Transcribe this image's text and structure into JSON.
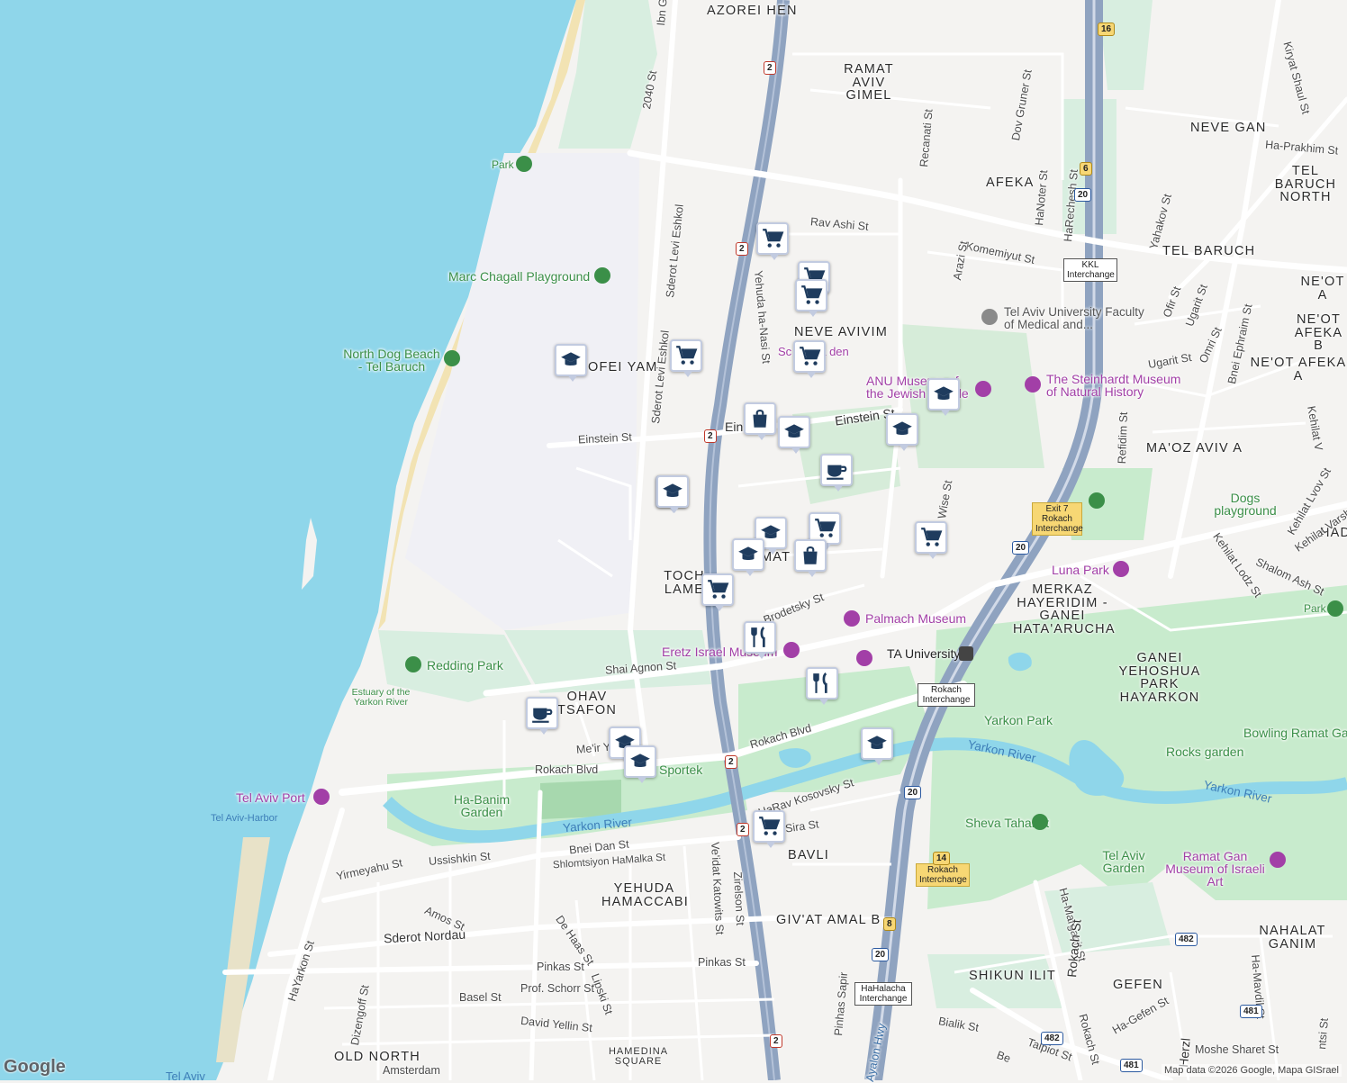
{
  "neighborhoods": [
    {
      "id": "azorei-hen",
      "text": "AZOREI HEN"
    },
    {
      "id": "ramat-aviv-gimel",
      "text": "RAMAT AVIV GIMEL"
    },
    {
      "id": "neve-gan",
      "text": "NEVE GAN"
    },
    {
      "id": "tel-baruch-north",
      "text": "TEL BARUCH NORTH"
    },
    {
      "id": "afeka",
      "text": "AFEKA"
    },
    {
      "id": "tel-baruch",
      "text": "TEL BARUCH"
    },
    {
      "id": "neot-afeka",
      "text": "NE'OT A"
    },
    {
      "id": "neot-afeka-2",
      "text": "NE'OT AFEKA B"
    },
    {
      "id": "neot-afeka-a",
      "text": "NE'OT AFEKA A"
    },
    {
      "id": "neve-avivim",
      "text": "NEVE AVIVIM"
    },
    {
      "id": "tzofei-yam",
      "text": "OFEI YAM"
    },
    {
      "id": "maoz-aviv-a",
      "text": "MA'OZ AVIV A"
    },
    {
      "id": "had",
      "text": "HAD"
    },
    {
      "id": "tochnit-lamed",
      "text": "TOCH LAME"
    },
    {
      "id": "ramat-aviv",
      "text": "MAT"
    },
    {
      "id": "merkaz",
      "text": "MERKAZ HAYERIDIM - GANEI HATA'ARUCHA"
    },
    {
      "id": "ganei-yehoshua",
      "text": "GANEI YEHOSHUA PARK HAYARKON"
    },
    {
      "id": "kochav-hatsafon",
      "text": "OHAV TSAFON"
    },
    {
      "id": "bavli",
      "text": "BAVLI"
    },
    {
      "id": "yehuda-hamaccabi",
      "text": "YEHUDA HAMACCABI"
    },
    {
      "id": "givat-amal",
      "text": "GIV'AT AMAL B"
    },
    {
      "id": "nahalat-ganim",
      "text": "NAHALAT GANIM"
    },
    {
      "id": "shikun-ilit",
      "text": "SHIKUN ILIT"
    },
    {
      "id": "gefen",
      "text": "GEFEN"
    },
    {
      "id": "old-north",
      "text": "OLD NORTH"
    }
  ],
  "streets": [
    {
      "id": "ibn-gvirol",
      "text": "Ibn Gv"
    },
    {
      "id": "st-2040",
      "text": "2040 St"
    },
    {
      "id": "levi-eshkol",
      "text": "Sderot Levi Eshkol"
    },
    {
      "id": "rav-ashi",
      "text": "Rav Ashi St"
    },
    {
      "id": "komemiyut",
      "text": "Komemiyut St"
    },
    {
      "id": "recanati",
      "text": "Recanati St"
    },
    {
      "id": "dov-gruner",
      "text": "Dov Gruner St"
    },
    {
      "id": "hanoter",
      "text": "HaNoter St"
    },
    {
      "id": "harechesh",
      "text": "HaRechesh St"
    },
    {
      "id": "ha-prakhim",
      "text": "Ha-Prakhim St"
    },
    {
      "id": "kiryat-shaul",
      "text": "Kiryat Shaul St"
    },
    {
      "id": "yahakov",
      "text": "Yahakov St"
    },
    {
      "id": "arazi",
      "text": "Arazi St"
    },
    {
      "id": "yehuda-hanasi",
      "text": "Yehuda ha-Nasi St"
    },
    {
      "id": "einstein-1",
      "text": "Einstein St"
    },
    {
      "id": "einstein-2",
      "text": "Einstein St"
    },
    {
      "id": "einstein-3",
      "text": "Ein"
    },
    {
      "id": "levi-eshkol-2",
      "text": "Sderot Levi Eshkol"
    },
    {
      "id": "ofir",
      "text": "Ofir St"
    },
    {
      "id": "ugarit",
      "text": "Ugarit St"
    },
    {
      "id": "ugarit-2",
      "text": "Ugarit St"
    },
    {
      "id": "omri",
      "text": "Omri St"
    },
    {
      "id": "bnei-ephraim",
      "text": "Bnei Ephraim St"
    },
    {
      "id": "refidim",
      "text": "Refidim St"
    },
    {
      "id": "kehilat-lvov",
      "text": "Kehilat Lvov St"
    },
    {
      "id": "kehilat-varsha",
      "text": "Kehilat Varsha St"
    },
    {
      "id": "kehilat-lodz",
      "text": "Kehilat Lodz St"
    },
    {
      "id": "shalom-ash",
      "text": "Shalom Ash St"
    },
    {
      "id": "kehilat",
      "text": "Kehilat V"
    },
    {
      "id": "brodetsky",
      "text": "Brodetsky St"
    },
    {
      "id": "wise",
      "text": "Wise St"
    },
    {
      "id": "shai-agnon",
      "text": "Shai Agnon St"
    },
    {
      "id": "rokach-blvd-1",
      "text": "Rokach Blvd"
    },
    {
      "id": "rokach-blvd-2",
      "text": "Rokach Blvd"
    },
    {
      "id": "meir-yaari",
      "text": "Me'ir Ya"
    },
    {
      "id": "harav-kosovsky",
      "text": "HaRav Kosovsky St"
    },
    {
      "id": "sira",
      "text": "Sira St"
    },
    {
      "id": "bnei-dan",
      "text": "Bnei Dan St"
    },
    {
      "id": "ussishkin",
      "text": "Ussishkin St"
    },
    {
      "id": "yirmeyahu",
      "text": "Yirmeyahu St"
    },
    {
      "id": "shlomtsiyon",
      "text": "Shlomtsiyon HaMalka St"
    },
    {
      "id": "veidat-katowitz",
      "text": "Ve'idat Katowits St"
    },
    {
      "id": "zirelson",
      "text": "Zirelson St"
    },
    {
      "id": "amos",
      "text": "Amos St"
    },
    {
      "id": "de-haas",
      "text": "De Haas St"
    },
    {
      "id": "sderot-nordau",
      "text": "Sderot Nordau"
    },
    {
      "id": "pinkas-1",
      "text": "Pinkas St"
    },
    {
      "id": "pinkas-2",
      "text": "Pinkas St"
    },
    {
      "id": "lipski",
      "text": "Lipski St"
    },
    {
      "id": "prof-schorr",
      "text": "Prof. Schorr St"
    },
    {
      "id": "basel",
      "text": "Basel St"
    },
    {
      "id": "david-yellin",
      "text": "David Yellin St"
    },
    {
      "id": "hamedina",
      "text": "HAMEDINA SQUARE"
    },
    {
      "id": "amsterdam",
      "text": "Amsterdam"
    },
    {
      "id": "dizengoff",
      "text": "Dizengoff St"
    },
    {
      "id": "hayarkon-st",
      "text": "HaYarkon St"
    },
    {
      "id": "bialik",
      "text": "Bialik St"
    },
    {
      "id": "pinhas-sapir",
      "text": "Pinhas Sapir"
    },
    {
      "id": "ayalon",
      "text": "Ayalon Hwy"
    },
    {
      "id": "ha-marganit",
      "text": "Ha-Marganit St"
    },
    {
      "id": "rokach-st",
      "text": "Rokach St"
    },
    {
      "id": "rokach-st-2",
      "text": "Rokach St"
    },
    {
      "id": "ha-gefen",
      "text": "Ha-Gefen St"
    },
    {
      "id": "talpiot",
      "text": "Talpiot St"
    },
    {
      "id": "moshe-sharet",
      "text": "Moshe Sharet St"
    },
    {
      "id": "ha-mavdil",
      "text": "Ha-Mavdil St"
    },
    {
      "id": "herzl",
      "text": "Herzl"
    },
    {
      "id": "bet",
      "text": "Be"
    },
    {
      "id": "vitsi",
      "text": "ntsi St"
    }
  ],
  "pois": [
    {
      "id": "park",
      "text": "Park"
    },
    {
      "id": "marc-chagall",
      "text": "Marc Chagall Playground"
    },
    {
      "id": "north-dog-beach",
      "text": "North Dog Beach - Tel Baruch"
    },
    {
      "id": "tau-medical",
      "text": "Tel Aviv University Faculty of Medical and..."
    },
    {
      "id": "anu-museum",
      "text": "ANU Museum of the Jewish People"
    },
    {
      "id": "steinhardt",
      "text": "The Steinhardt Museum of Natural History"
    },
    {
      "id": "dogs-playground",
      "text": "Dogs playground"
    },
    {
      "id": "luna-park",
      "text": "Luna Park"
    },
    {
      "id": "park-right",
      "text": "Park"
    },
    {
      "id": "palmach",
      "text": "Palmach Museum"
    },
    {
      "id": "eretz-israel",
      "text": "Eretz Israel Museum"
    },
    {
      "id": "ta-university",
      "text": "TA University"
    },
    {
      "id": "redding-park",
      "text": "Redding Park"
    },
    {
      "id": "estuary",
      "text": "Estuary of the Yarkon River"
    },
    {
      "id": "tel-aviv-port",
      "text": "Tel Aviv Port"
    },
    {
      "id": "tel-aviv-harbor",
      "text": "Tel Aviv-Harbor"
    },
    {
      "id": "habanim",
      "text": "Ha-Banim Garden"
    },
    {
      "id": "sportek",
      "text": "Sportek"
    },
    {
      "id": "yarkon-park",
      "text": "Yarkon Park"
    },
    {
      "id": "rocks-garden",
      "text": "Rocks garden"
    },
    {
      "id": "bowling",
      "text": "Bowling Ramat Ga"
    },
    {
      "id": "sheva-tahanot",
      "text": "Sheva Tahanot"
    },
    {
      "id": "tel-aviv-garden",
      "text": "Tel Aviv Garden"
    },
    {
      "id": "ramat-gan-museum",
      "text": "Ramat Gan Museum of Israeli Art"
    },
    {
      "id": "school-label",
      "text": "Sc sy Ma den"
    },
    {
      "id": "tel-aviv-bottom",
      "text": "Tel Aviv"
    }
  ],
  "water_labels": [
    {
      "id": "yarkon-river-1",
      "text": "Yarkon River"
    },
    {
      "id": "yarkon-river-2",
      "text": "Yarkon River"
    },
    {
      "id": "yarkon-river-3",
      "text": "Yarkon River"
    }
  ],
  "interchanges": [
    {
      "id": "kkl",
      "text": "KKL Interchange"
    },
    {
      "id": "rokach-exit7",
      "text": "Exit 7 Rokach Interchange"
    },
    {
      "id": "rokach-main",
      "text": "Rokach Interchange"
    },
    {
      "id": "rokach-14",
      "text": "Rokach Interchange"
    },
    {
      "id": "hahalacha",
      "text": "HaHalacha Interchange"
    }
  ],
  "shields": [
    {
      "id": "r2-a",
      "text": "2"
    },
    {
      "id": "r2-b",
      "text": "2"
    },
    {
      "id": "r2-c",
      "text": "2"
    },
    {
      "id": "r2-d",
      "text": "2"
    },
    {
      "id": "r2-e",
      "text": "2"
    },
    {
      "id": "r2-f",
      "text": "2"
    },
    {
      "id": "r20-a",
      "text": "20"
    },
    {
      "id": "r20-b",
      "text": "20"
    },
    {
      "id": "r20-c",
      "text": "20"
    },
    {
      "id": "r20-d",
      "text": "20"
    },
    {
      "id": "r16",
      "text": "16"
    },
    {
      "id": "r6",
      "text": "6"
    },
    {
      "id": "r8",
      "text": "8"
    },
    {
      "id": "r14",
      "text": "14"
    },
    {
      "id": "r482-a",
      "text": "482"
    },
    {
      "id": "r482-b",
      "text": "482"
    },
    {
      "id": "r481-a",
      "text": "481"
    },
    {
      "id": "r481-b",
      "text": "481"
    }
  ],
  "markers": [
    {
      "id": "m1",
      "type": "cart"
    },
    {
      "id": "m2",
      "type": "cart"
    },
    {
      "id": "m3",
      "type": "cart"
    },
    {
      "id": "m4",
      "type": "cart"
    },
    {
      "id": "m5",
      "type": "school"
    },
    {
      "id": "m6",
      "type": "cart"
    },
    {
      "id": "m7",
      "type": "school"
    },
    {
      "id": "m8",
      "type": "shop"
    },
    {
      "id": "m9",
      "type": "school"
    },
    {
      "id": "m10",
      "type": "school"
    },
    {
      "id": "m11",
      "type": "school"
    },
    {
      "id": "m12",
      "type": "cafe"
    },
    {
      "id": "m13",
      "type": "school"
    },
    {
      "id": "m14",
      "type": "cart"
    },
    {
      "id": "m15",
      "type": "school"
    },
    {
      "id": "m16",
      "type": "school"
    },
    {
      "id": "m17",
      "type": "shop"
    },
    {
      "id": "m18",
      "type": "cart"
    },
    {
      "id": "m19",
      "type": "cart"
    },
    {
      "id": "m20",
      "type": "restaurant"
    },
    {
      "id": "m21",
      "type": "restaurant"
    },
    {
      "id": "m22",
      "type": "cafe"
    },
    {
      "id": "m23",
      "type": "school"
    },
    {
      "id": "m24",
      "type": "school"
    },
    {
      "id": "m25",
      "type": "school"
    },
    {
      "id": "m26",
      "type": "cart"
    }
  ],
  "footer": {
    "logo": "Google",
    "attribution": "Map data ©2026 Google, Mapa GISrael"
  },
  "colors": {
    "water": "#8fd6ea",
    "land": "#f4f3f1",
    "park": "#c8ebcd",
    "highway": "#8fa3c0",
    "marker_icon": "#1f3c5e"
  }
}
